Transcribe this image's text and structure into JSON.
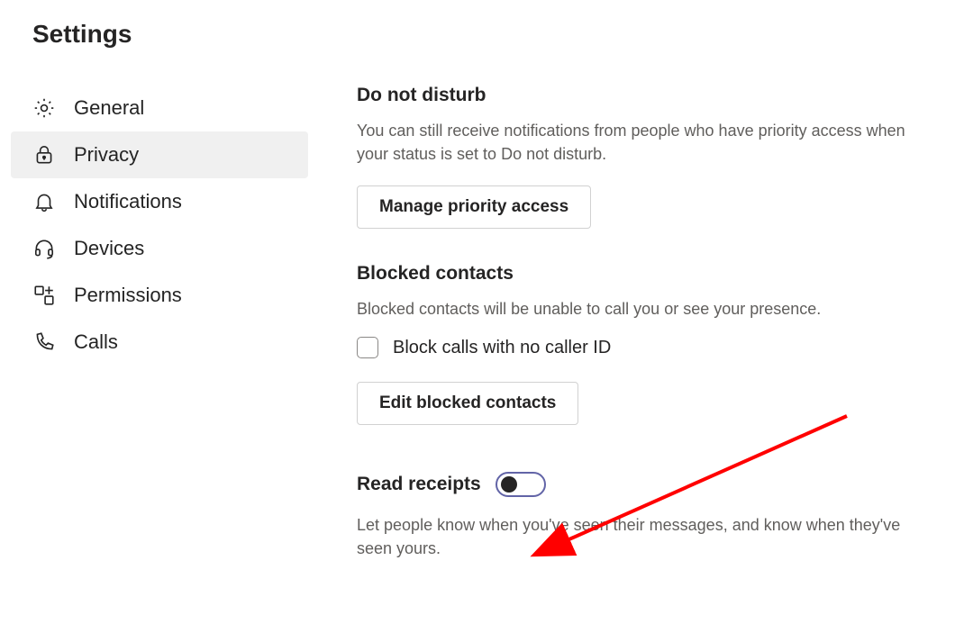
{
  "page_title": "Settings",
  "sidebar": {
    "items": [
      {
        "label": "General",
        "icon": "gear-icon",
        "selected": false
      },
      {
        "label": "Privacy",
        "icon": "lock-icon",
        "selected": true
      },
      {
        "label": "Notifications",
        "icon": "bell-icon",
        "selected": false
      },
      {
        "label": "Devices",
        "icon": "headset-icon",
        "selected": false
      },
      {
        "label": "Permissions",
        "icon": "apps-icon",
        "selected": false
      },
      {
        "label": "Calls",
        "icon": "phone-icon",
        "selected": false
      }
    ]
  },
  "content": {
    "dnd": {
      "heading": "Do not disturb",
      "desc": "You can still receive notifications from people who have priority access when your status is set to Do not disturb.",
      "button": "Manage priority access"
    },
    "blocked": {
      "heading": "Blocked contacts",
      "desc": "Blocked contacts will be unable to call you or see your presence.",
      "checkbox_label": "Block calls with no caller ID",
      "checkbox_checked": false,
      "button": "Edit blocked contacts"
    },
    "read_receipts": {
      "heading": "Read receipts",
      "toggle_on": false,
      "desc": "Let people know when you've seen their messages, and know when they've seen yours."
    }
  },
  "annotation": {
    "arrow_color": "#ff0000"
  }
}
